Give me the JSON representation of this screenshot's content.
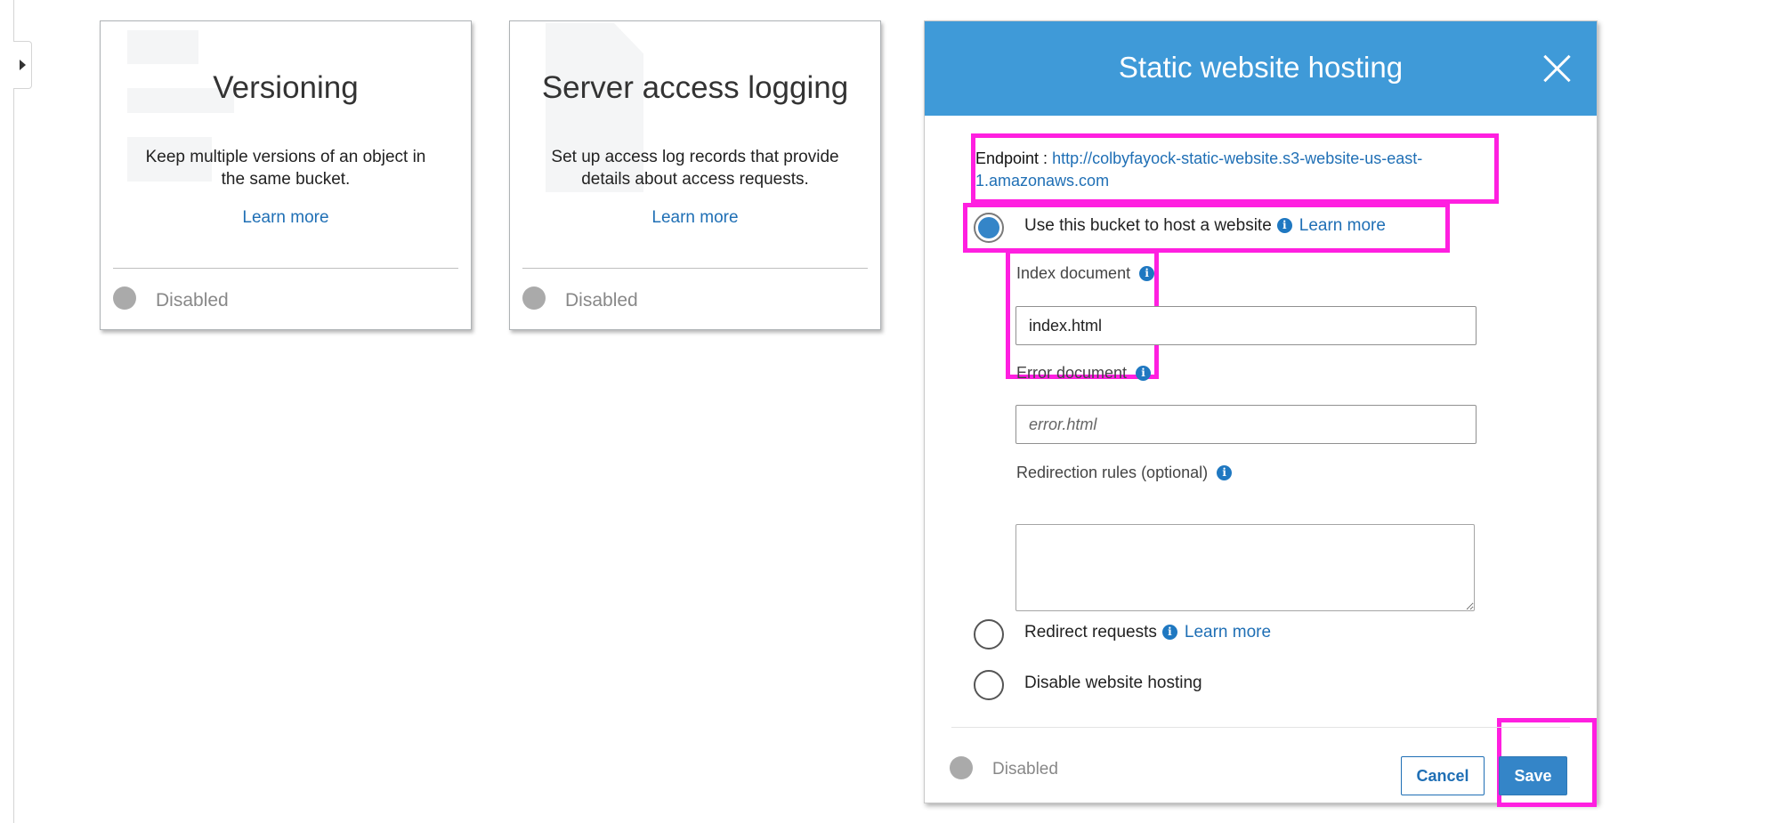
{
  "cards": [
    {
      "title": "Versioning",
      "description": "Keep multiple versions of an object in the same bucket.",
      "learn_more": "Learn more",
      "status": "Disabled"
    },
    {
      "title": "Server access logging",
      "description": "Set up access log records that provide details about access requests.",
      "learn_more": "Learn more",
      "status": "Disabled"
    }
  ],
  "modal": {
    "title": "Static website hosting",
    "endpoint_label": "Endpoint :",
    "endpoint_url": "http://colbyfayock-static-website.s3-website-us-east-1.amazonaws.com",
    "options": [
      {
        "label": "Use this bucket to host a website",
        "learn_more": "Learn more",
        "selected": true
      },
      {
        "label": "Redirect requests",
        "learn_more": "Learn more",
        "selected": false
      },
      {
        "label": "Disable website hosting",
        "selected": false
      }
    ],
    "index_document": {
      "label": "Index document",
      "value": "index.html"
    },
    "error_document": {
      "label": "Error document",
      "placeholder": "error.html",
      "value": ""
    },
    "redirection_rules": {
      "label": "Redirection rules (optional)",
      "value": ""
    },
    "status": "Disabled",
    "cancel_label": "Cancel",
    "save_label": "Save"
  },
  "colors": {
    "header_bg": "#3f9ad8",
    "link": "#1f6fb5",
    "highlight": "#ff1fe0",
    "primary_button": "#3485c8"
  }
}
